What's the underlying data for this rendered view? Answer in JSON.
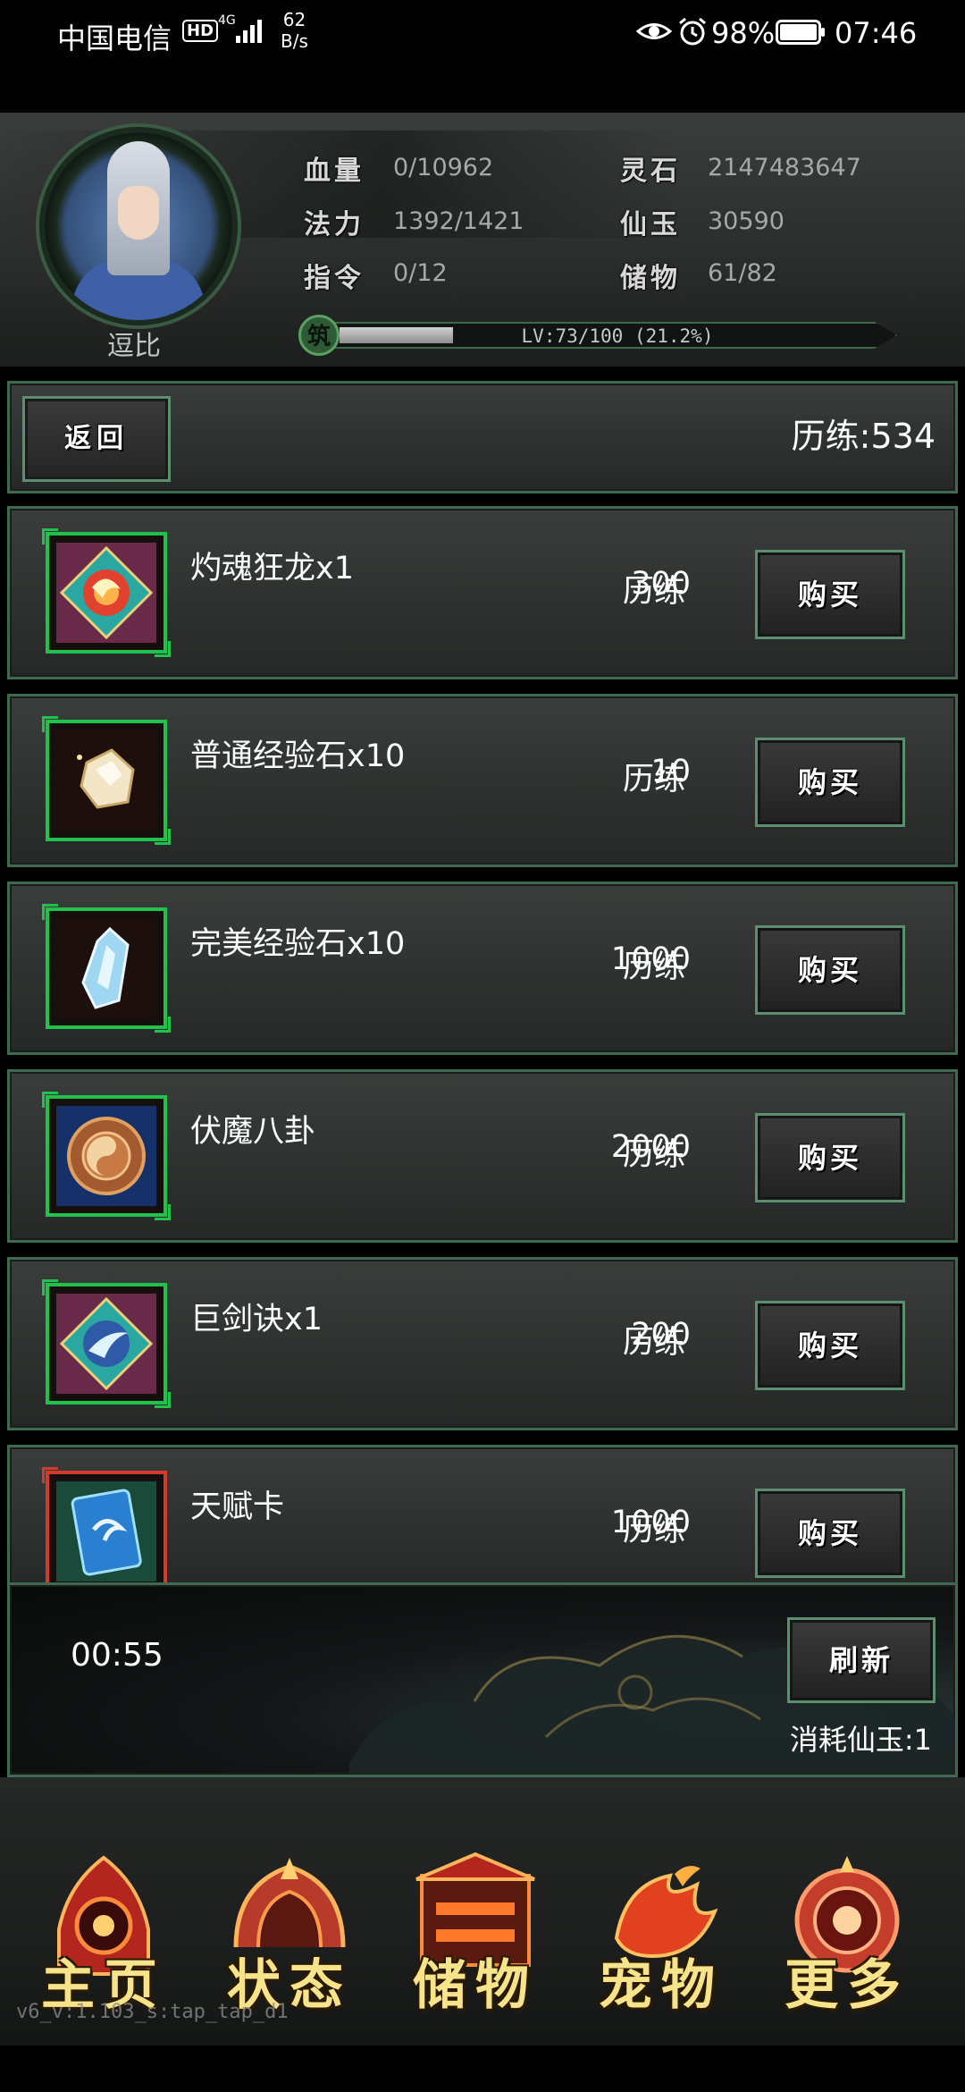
{
  "status_bar": {
    "carrier": "中国电信",
    "hd": "HD",
    "network": "4G",
    "speed_value": "62",
    "speed_unit": "B/s",
    "battery": "98%",
    "time": "07:46"
  },
  "player": {
    "name": "逗比",
    "stats": {
      "hp_label": "血量",
      "hp_value": "0/10962",
      "mp_label": "法力",
      "mp_value": "1392/1421",
      "cmd_label": "指令",
      "cmd_value": "0/12",
      "stone_label": "灵石",
      "stone_value": "2147483647",
      "jade_label": "仙玉",
      "jade_value": "30590",
      "storage_label": "储物",
      "storage_value": "61/82"
    },
    "realm_badge": "筑",
    "level_text": "LV:73/100 (21.2%)",
    "level_progress": 0.212
  },
  "shop": {
    "back_label": "返回",
    "experience_total": "历练:534",
    "buy_label": "购买",
    "items": [
      {
        "name": "灼魂狂龙x1",
        "price": "300",
        "unit": "历练",
        "icon": "fire-dragon-skillbook-icon"
      },
      {
        "name": "普通经验石x10",
        "price": "10",
        "unit": "历练",
        "icon": "common-exp-stone-icon"
      },
      {
        "name": "完美经验石x10",
        "price": "1000",
        "unit": "历练",
        "icon": "perfect-exp-stone-icon"
      },
      {
        "name": "伏魔八卦",
        "price": "2000",
        "unit": "历练",
        "icon": "bagua-seal-icon"
      },
      {
        "name": "巨剑诀x1",
        "price": "200",
        "unit": "历练",
        "icon": "giant-sword-skillbook-icon"
      },
      {
        "name": "天赋卡",
        "price": "1000",
        "unit": "历练",
        "icon": "talent-card-icon"
      }
    ],
    "timer": "00:55",
    "refresh_label": "刷新",
    "refresh_cost": "消耗仙玉:1"
  },
  "nav": {
    "items": [
      {
        "label": "主页",
        "icon": "home-emblem-icon"
      },
      {
        "label": "状态",
        "icon": "status-emblem-icon"
      },
      {
        "label": "储物",
        "icon": "storage-emblem-icon"
      },
      {
        "label": "宠物",
        "icon": "pet-phoenix-icon"
      },
      {
        "label": "更多",
        "icon": "more-emblem-icon"
      }
    ]
  },
  "version": "v6_v:1.103_s:tap_tap_d1",
  "colors": {
    "accent_green": "#1fc24a",
    "frame_green": "#3d6a50",
    "nav_gold": "#f6e38a"
  }
}
